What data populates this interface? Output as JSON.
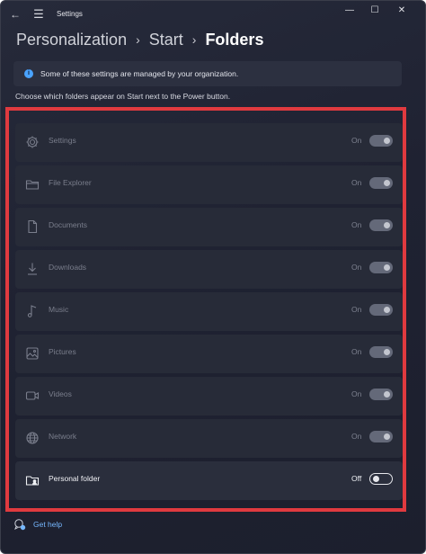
{
  "window": {
    "title": "Settings",
    "controls": {
      "minimize": "—",
      "maximize": "☐",
      "close": "✕"
    }
  },
  "breadcrumb": {
    "items": [
      "Personalization",
      "Start",
      "Folders"
    ],
    "separator": "›"
  },
  "info_banner": {
    "icon": "info-icon",
    "text": "Some of these settings are managed by your organization."
  },
  "instructions": "Choose which folders appear on Start next to the Power button.",
  "folders": [
    {
      "label": "Settings",
      "icon": "gear-icon",
      "state": "On",
      "enabled": false
    },
    {
      "label": "File Explorer",
      "icon": "folder-icon",
      "state": "On",
      "enabled": false
    },
    {
      "label": "Documents",
      "icon": "document-icon",
      "state": "On",
      "enabled": false
    },
    {
      "label": "Downloads",
      "icon": "download-icon",
      "state": "On",
      "enabled": false
    },
    {
      "label": "Music",
      "icon": "music-icon",
      "state": "On",
      "enabled": false
    },
    {
      "label": "Pictures",
      "icon": "picture-icon",
      "state": "On",
      "enabled": false
    },
    {
      "label": "Videos",
      "icon": "video-icon",
      "state": "On",
      "enabled": false
    },
    {
      "label": "Network",
      "icon": "globe-icon",
      "state": "On",
      "enabled": false
    },
    {
      "label": "Personal folder",
      "icon": "personal-folder-icon",
      "state": "Off",
      "enabled": true
    }
  ],
  "help": {
    "label": "Get help",
    "icon": "help-chat-icon"
  },
  "colors": {
    "accent_link": "#76b7ff",
    "highlight_border": "#e03a3f",
    "info_icon": "#4aa3ff"
  }
}
